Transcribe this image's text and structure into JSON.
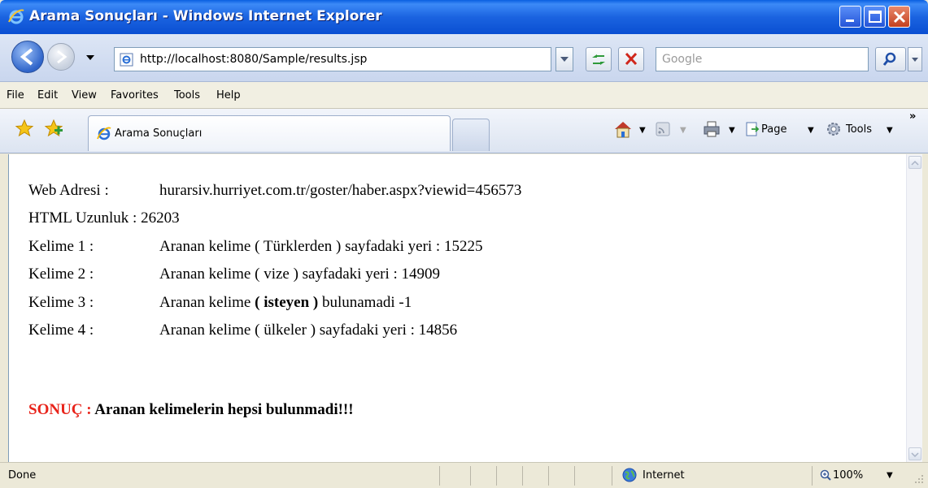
{
  "window": {
    "title": "Arama Sonuçları - Windows Internet Explorer"
  },
  "address": {
    "url": "http://localhost:8080/Sample/results.jsp"
  },
  "search": {
    "placeholder": "Google"
  },
  "menu": {
    "items": [
      "File",
      "Edit",
      "View",
      "Favorites",
      "Tools",
      "Help"
    ]
  },
  "tab": {
    "title": "Arama Sonuçları"
  },
  "commands": {
    "page_label": "Page",
    "tools_label": "Tools"
  },
  "content": {
    "rows": [
      {
        "label": "Web Adresi :",
        "value": "hurarsiv.hurriyet.com.tr/goster/haber.aspx?viewid=456573"
      },
      {
        "label": "HTML Uzunluk :",
        "value": "26203"
      },
      {
        "label": "Kelime 1 :",
        "value": "Aranan kelime ( Türklerden ) sayfadaki yeri : 15225"
      },
      {
        "label": "Kelime 2 :",
        "value": "Aranan kelime ( vize ) sayfadaki yeri : 14909"
      },
      {
        "label": "Kelime 3 :",
        "value_prefix": "Aranan kelime ",
        "value_bold": "( isteyen )",
        "value_suffix": " bulunamadi -1"
      },
      {
        "label": "Kelime 4 :",
        "value": "Aranan kelime ( ülkeler ) sayfadaki yeri : 14856"
      }
    ],
    "result_label": "SONUÇ :",
    "result_text": " Aranan kelimelerin hepsi bulunmadi!!!"
  },
  "status": {
    "text": "Done",
    "zone": "Internet",
    "zoom": "100%"
  },
  "colors": {
    "titlebar": "#0A4FD2",
    "result_label": "#E8231A",
    "chrome": "#ECE9D8"
  },
  "icons": [
    "ie-logo-icon",
    "minimize-icon",
    "maximize-icon",
    "close-icon",
    "back-icon",
    "forward-icon",
    "page-icon",
    "refresh-icon",
    "stop-icon",
    "search-icon",
    "favorites-star-icon",
    "add-favorite-icon",
    "home-icon",
    "feeds-icon",
    "print-icon",
    "gear-icon",
    "globe-icon",
    "zoom-icon"
  ]
}
